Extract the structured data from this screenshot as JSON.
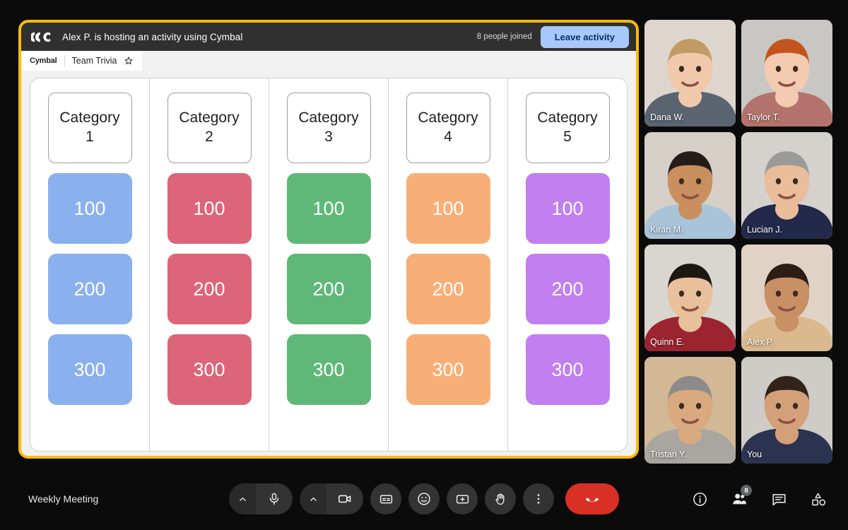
{
  "activity": {
    "header": {
      "logo_icon": "cymbal-logo-icon",
      "host_text": "Alex P. is hosting an activity using Cymbal",
      "people_joined": "8 people joined",
      "leave_label": "Leave activity"
    },
    "subbar": {
      "brand": "Cymbal",
      "name": "Team Trivia",
      "star_icon": "star-outline-icon"
    },
    "board": {
      "columns": [
        {
          "category": "Category 1",
          "color": "#8ab0ee",
          "values": [
            "100",
            "200",
            "300"
          ]
        },
        {
          "category": "Category 2",
          "color": "#dc6579",
          "values": [
            "100",
            "200",
            "300"
          ]
        },
        {
          "category": "Category 3",
          "color": "#5fb877",
          "values": [
            "100",
            "200",
            "300"
          ]
        },
        {
          "category": "Category 4",
          "color": "#f8ae77",
          "values": [
            "100",
            "200",
            "300"
          ]
        },
        {
          "category": "Category 5",
          "color": "#c17ff0",
          "values": [
            "100",
            "200",
            "300"
          ]
        }
      ]
    }
  },
  "participants": [
    {
      "name": "Dana W.",
      "is_you": false
    },
    {
      "name": "Taylor T.",
      "is_you": false
    },
    {
      "name": "Kiran M.",
      "is_you": false
    },
    {
      "name": "Lucian J.",
      "is_you": false
    },
    {
      "name": "Quinn E.",
      "is_you": false
    },
    {
      "name": "Alex P.",
      "is_you": false
    },
    {
      "name": "Tristan Y.",
      "is_you": false
    },
    {
      "name": "You",
      "is_you": true
    }
  ],
  "bottom_bar": {
    "meeting_title": "Weekly Meeting",
    "controls": [
      {
        "icon": "microphone-icon",
        "name": "mic-button"
      },
      {
        "icon": "camera-icon",
        "name": "camera-button"
      },
      {
        "icon": "captions-icon",
        "name": "captions-button"
      },
      {
        "icon": "emoji-icon",
        "name": "emoji-button"
      },
      {
        "icon": "present-icon",
        "name": "present-button"
      },
      {
        "icon": "raise-hand-icon",
        "name": "raise-hand-button"
      },
      {
        "icon": "more-options-icon",
        "name": "more-options-button"
      },
      {
        "icon": "end-call-icon",
        "name": "end-call-button"
      }
    ],
    "right_controls": [
      {
        "icon": "info-icon",
        "name": "meeting-details-button"
      },
      {
        "icon": "people-icon",
        "name": "people-button",
        "badge": "8"
      },
      {
        "icon": "chat-icon",
        "name": "chat-button"
      },
      {
        "icon": "activities-icon",
        "name": "activities-button"
      }
    ],
    "people_count_badge": "8"
  },
  "colors": {
    "frame_accent": "#fbbc04",
    "leave_button": "#a8c7fa",
    "end_call": "#d93025",
    "active_speaker_border": "#8ab4f8",
    "header_bg": "#303030"
  }
}
